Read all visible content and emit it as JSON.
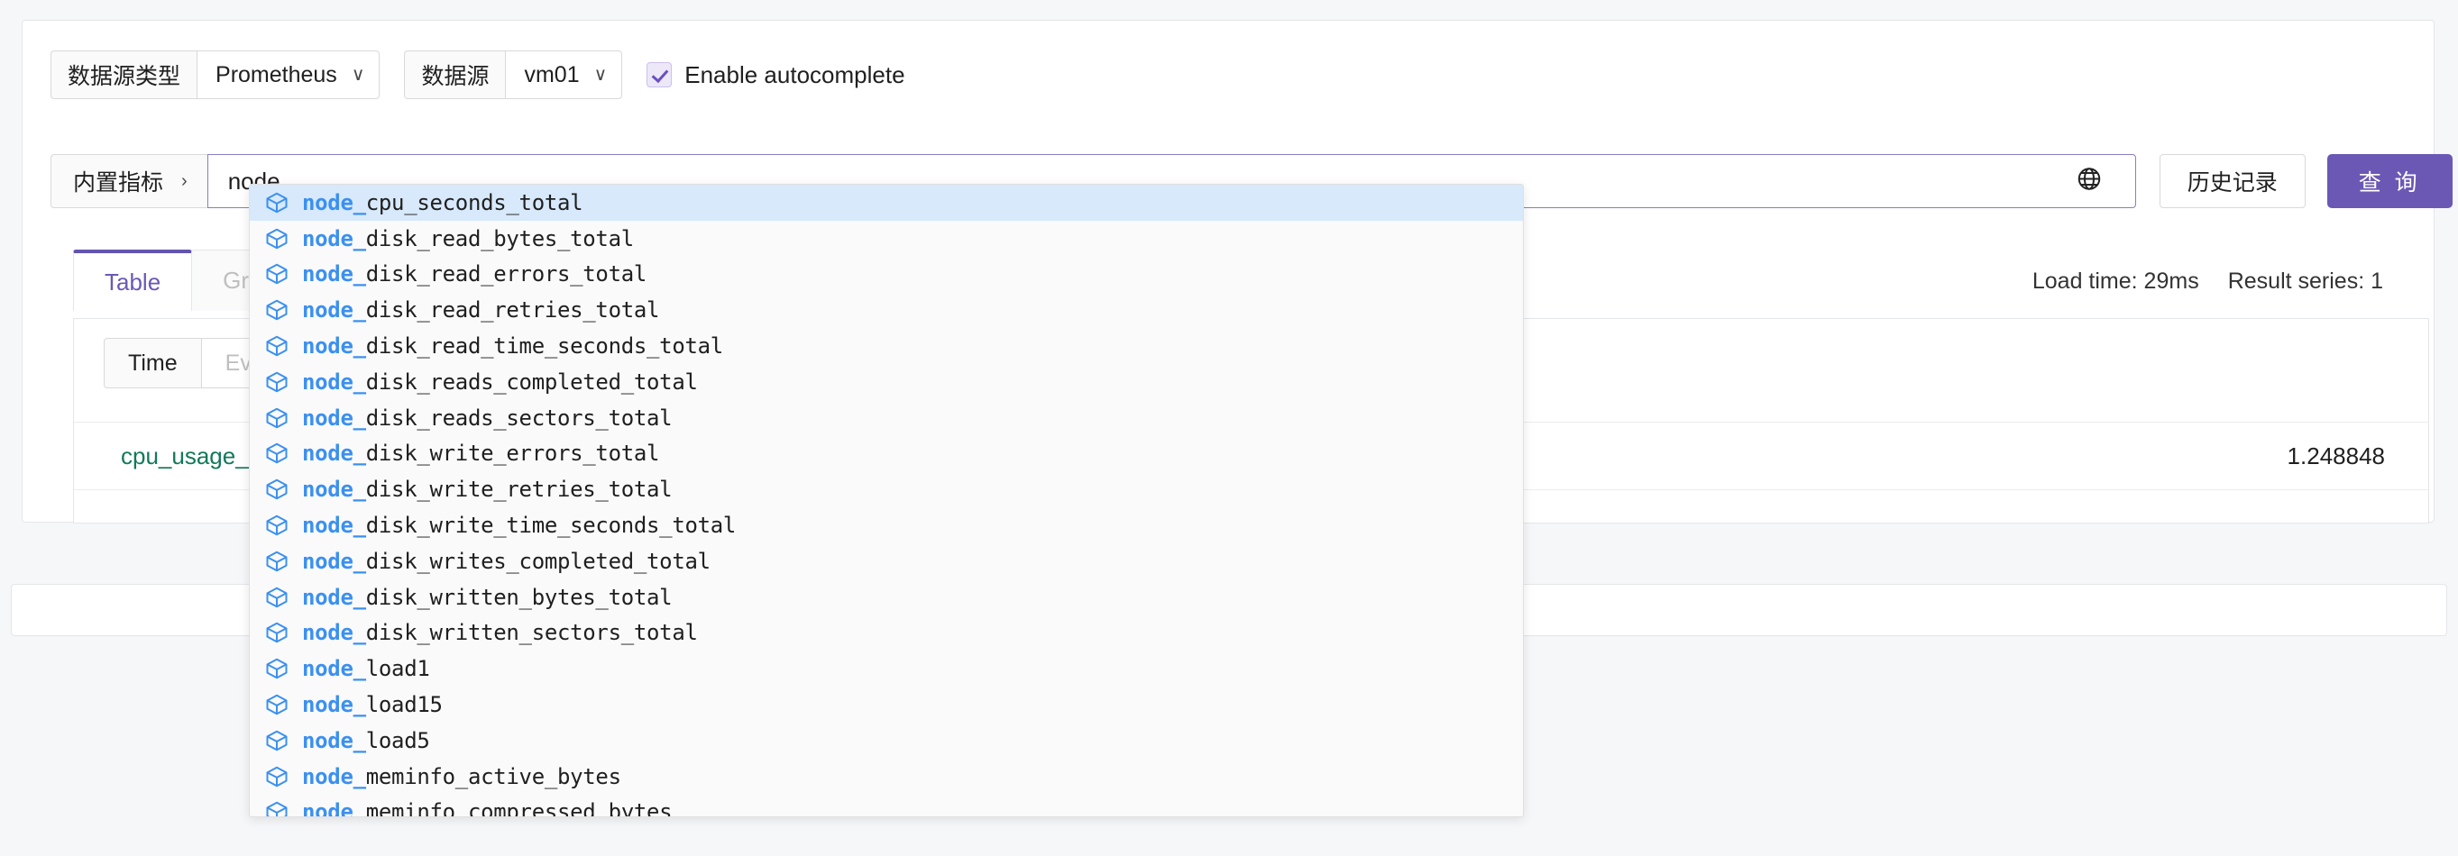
{
  "toolbar": {
    "datasource_type_label": "数据源类型",
    "datasource_type_value": "Prometheus",
    "datasource_label": "数据源",
    "datasource_value": "vm01",
    "autocomplete_label": "Enable autocomplete",
    "autocomplete_checked": true,
    "chevron_icon": "chevron-down-icon"
  },
  "query": {
    "prefix_label": "内置指标",
    "prefix_chevron_icon": "chevron-right-icon",
    "value": "node_",
    "placeholder": "",
    "globe_icon": "globe-icon",
    "history_label": "历史记录",
    "run_label": "查 询"
  },
  "tabs": [
    {
      "label": "Table",
      "active": true
    },
    {
      "label": "Graph",
      "active": false
    }
  ],
  "meta": {
    "load_time": "Load time: 29ms",
    "result_series": "Result series: 1"
  },
  "toggles": [
    {
      "label": "Time",
      "active": true
    },
    {
      "label": "Evaluation time",
      "active": false
    }
  ],
  "result_table": {
    "rows": [
      {
        "name": "cpu_usage_act",
        "value": "1.248848"
      }
    ]
  },
  "autocomplete": {
    "icon": "cube-icon",
    "highlight_prefix": "node_",
    "items": [
      {
        "prefix": "node_",
        "rest": "cpu_seconds_total",
        "selected": true
      },
      {
        "prefix": "node_",
        "rest": "disk_read_bytes_total",
        "selected": false
      },
      {
        "prefix": "node_",
        "rest": "disk_read_errors_total",
        "selected": false
      },
      {
        "prefix": "node_",
        "rest": "disk_read_retries_total",
        "selected": false
      },
      {
        "prefix": "node_",
        "rest": "disk_read_time_seconds_total",
        "selected": false
      },
      {
        "prefix": "node_",
        "rest": "disk_reads_completed_total",
        "selected": false
      },
      {
        "prefix": "node_",
        "rest": "disk_reads_sectors_total",
        "selected": false
      },
      {
        "prefix": "node_",
        "rest": "disk_write_errors_total",
        "selected": false
      },
      {
        "prefix": "node_",
        "rest": "disk_write_retries_total",
        "selected": false
      },
      {
        "prefix": "node_",
        "rest": "disk_write_time_seconds_total",
        "selected": false
      },
      {
        "prefix": "node_",
        "rest": "disk_writes_completed_total",
        "selected": false
      },
      {
        "prefix": "node_",
        "rest": "disk_written_bytes_total",
        "selected": false
      },
      {
        "prefix": "node_",
        "rest": "disk_written_sectors_total",
        "selected": false
      },
      {
        "prefix": "node_",
        "rest": "load1",
        "selected": false
      },
      {
        "prefix": "node_",
        "rest": "load15",
        "selected": false
      },
      {
        "prefix": "node_",
        "rest": "load5",
        "selected": false
      },
      {
        "prefix": "node_",
        "rest": "meminfo_active_bytes",
        "selected": false
      },
      {
        "prefix": "node_",
        "rest": "meminfo_compressed_bytes",
        "selected": false
      }
    ]
  },
  "colors": {
    "accent": "#6b58b5",
    "tab_active_border": "#6254b0",
    "metric_green": "#12795a",
    "autocomplete_prefix_blue": "#3b90f0",
    "selected_row_blue": "#d7e9fb",
    "page_bg": "#f6f7f9"
  }
}
